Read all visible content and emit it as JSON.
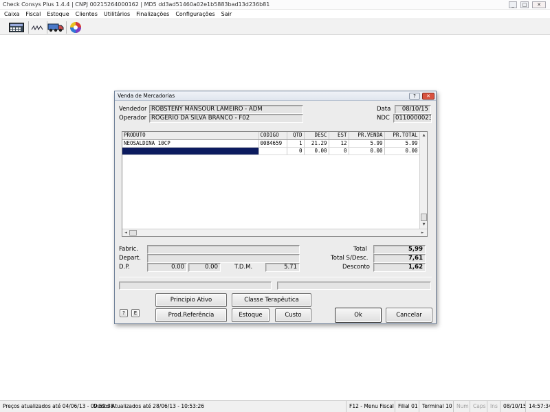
{
  "window": {
    "title": "Check Consys Plus 1.4.4 | CNPJ 00215264000162 | MD5 dd3ad51460a02e1b5883bad13d236b81",
    "buttons": {
      "minimize": "_",
      "maximize": "□",
      "close": "✕"
    }
  },
  "menu": [
    "Caixa",
    "Fiscal",
    "Estoque",
    "Clientes",
    "Utilitários",
    "Finalizações",
    "Configurações",
    "Sair"
  ],
  "toolbar": {
    "icons": [
      "calculator-icon",
      "signature-icon",
      "delivery-truck-icon",
      "color-wheel-icon"
    ]
  },
  "dialog": {
    "title": "Venda de Mercadorias",
    "help_btn": "?",
    "close_btn": "✕",
    "vendedor_label": "Vendedor",
    "vendedor": "ROBSTENY MANSOUR LAMEIRO - ADM",
    "operador_label": "Operador",
    "operador": "ROGERIO DA SILVA BRANCO - F02",
    "data_label": "Data",
    "data": "08/10/15",
    "ndc_label": "NDC",
    "ndc": "0110000023",
    "grid": {
      "columns": [
        "PRODUTO",
        "CODIGO",
        "QTD",
        "DESC",
        "EST",
        "PR.VENDA",
        "PR.TOTAL"
      ],
      "rows": [
        [
          "NEOSALDINA 10CP",
          "0084659",
          "1",
          "21.29",
          "12",
          "5.99",
          "5.99"
        ],
        [
          "",
          "",
          "0",
          "0.00",
          "0",
          "0.00",
          "0.00"
        ]
      ],
      "scroll_up": "▲",
      "scroll_down": "▼",
      "scroll_left": "◄",
      "scroll_right": "►"
    },
    "fabric_label": "Fabric.",
    "fabric": "",
    "depart_label": "Depart.",
    "depart": "",
    "dp_label": "D.P.",
    "dp1": "0.00",
    "dp2": "0.00",
    "tdm_label": "T.D.M.",
    "tdm": "5.71",
    "total_label": "Total",
    "total": "5,99",
    "total_sdesc_label": "Total S/Desc.",
    "total_sdesc": "7,61",
    "desconto_label": "Desconto",
    "desconto": "1,62",
    "info_left": "",
    "info_right": "",
    "buttons": {
      "q": "?",
      "e": "E",
      "principio_ativo": "Principio Ativo",
      "classe_terapeutica": "Classe Terapêutica",
      "prod_referencia": "Prod.Referência",
      "estoque": "Estoque",
      "custo": "Custo",
      "ok": "Ok",
      "cancelar": "Cancelar"
    }
  },
  "statusbar": {
    "precos": "Preços atualizados até 04/06/13 - 09:59:38",
    "dados": "Dados Atualizados até 28/06/13 - 10:53:26",
    "menu_fiscal": "F12 - Menu Fiscal",
    "filial": "Filial 01",
    "terminal": "Terminal 10",
    "num": "Num",
    "caps": "Caps",
    "ins": "Ins",
    "date": "08/10/15",
    "time": "14:57:34"
  },
  "colors": {
    "selection": "#0c1b5f",
    "dialog_bg": "#ececec",
    "close_btn": "#d8523f"
  }
}
